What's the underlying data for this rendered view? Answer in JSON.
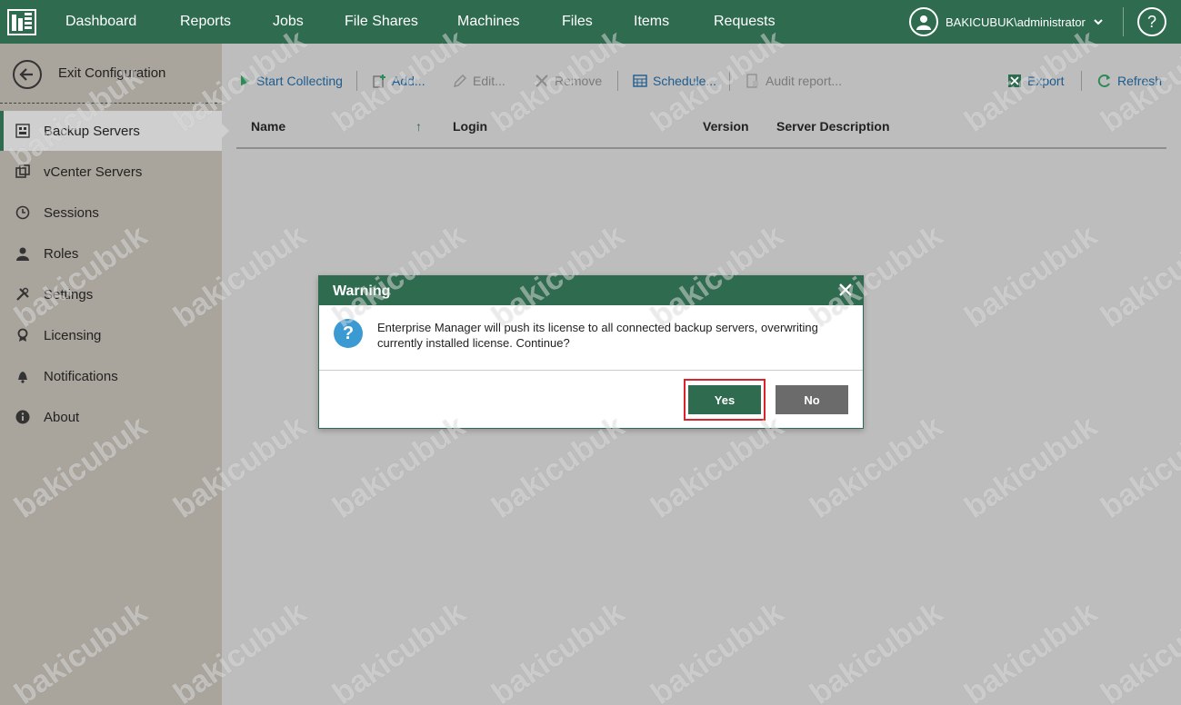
{
  "topnav": {
    "items": [
      "Dashboard",
      "Reports",
      "Jobs",
      "File Shares",
      "Machines",
      "Files",
      "Items",
      "Requests"
    ],
    "user": "BAKICUBUK\\administrator",
    "help_label": "?"
  },
  "sidebar": {
    "exit_label": "Exit Configuration",
    "items": [
      {
        "label": "Backup Servers",
        "icon": "backup-server-icon"
      },
      {
        "label": "vCenter Servers",
        "icon": "vcenter-icon"
      },
      {
        "label": "Sessions",
        "icon": "clock-icon"
      },
      {
        "label": "Roles",
        "icon": "person-icon"
      },
      {
        "label": "Settings",
        "icon": "tools-icon"
      },
      {
        "label": "Licensing",
        "icon": "license-icon"
      },
      {
        "label": "Notifications",
        "icon": "bell-icon"
      },
      {
        "label": "About",
        "icon": "info-icon"
      }
    ]
  },
  "toolbar": {
    "start_collecting": "Start Collecting",
    "add": "Add...",
    "edit": "Edit...",
    "remove": "Remove",
    "schedule": "Schedule...",
    "audit_report": "Audit report...",
    "export": "Export",
    "refresh": "Refresh"
  },
  "table": {
    "columns": [
      "Name",
      "Login",
      "Version",
      "Server Description"
    ],
    "sort_indicator": "↑"
  },
  "dialog": {
    "title": "Warning",
    "message": "Enterprise Manager will push its license to all connected backup servers, overwriting currently installed license. Continue?",
    "yes_label": "Yes",
    "no_label": "No",
    "question_glyph": "?"
  },
  "watermark": "bakicubuk",
  "colors": {
    "brand_green": "#2e6b4f",
    "link_blue": "#1d5c8f",
    "highlight_red": "#d9252a",
    "info_blue": "#3c9ad3"
  }
}
